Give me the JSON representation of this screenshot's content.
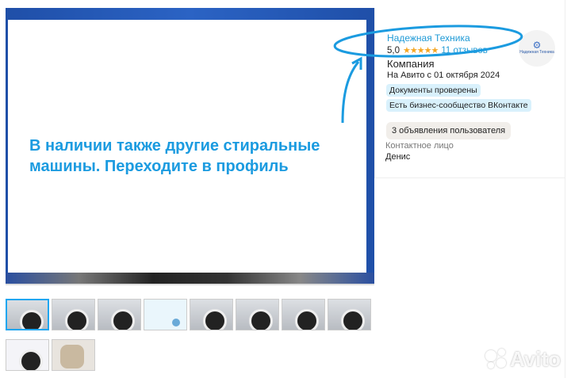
{
  "gallery": {
    "slide_text": "В наличии также другие стиральные машины. Переходите в профиль",
    "thumbnail_count": 10,
    "selected_thumbnail": 1
  },
  "seller": {
    "name": "Надежная Техника",
    "rating": "5,0",
    "stars": "★★★★★",
    "reviews": "11 отзывов",
    "type": "Компания",
    "since": "На Авито с 01 октября 2024",
    "badges": [
      "Документы проверены",
      "Есть бизнес-сообщество ВКонтакте"
    ],
    "ads_button": "3 объявления пользователя",
    "contact_label": "Контактное лицо",
    "contact_name": "Денис",
    "avatar_text": "Надежная Техника"
  },
  "watermark": "Avito",
  "colors": {
    "accent": "#1f9ad6",
    "annotation": "#1b9be0"
  }
}
